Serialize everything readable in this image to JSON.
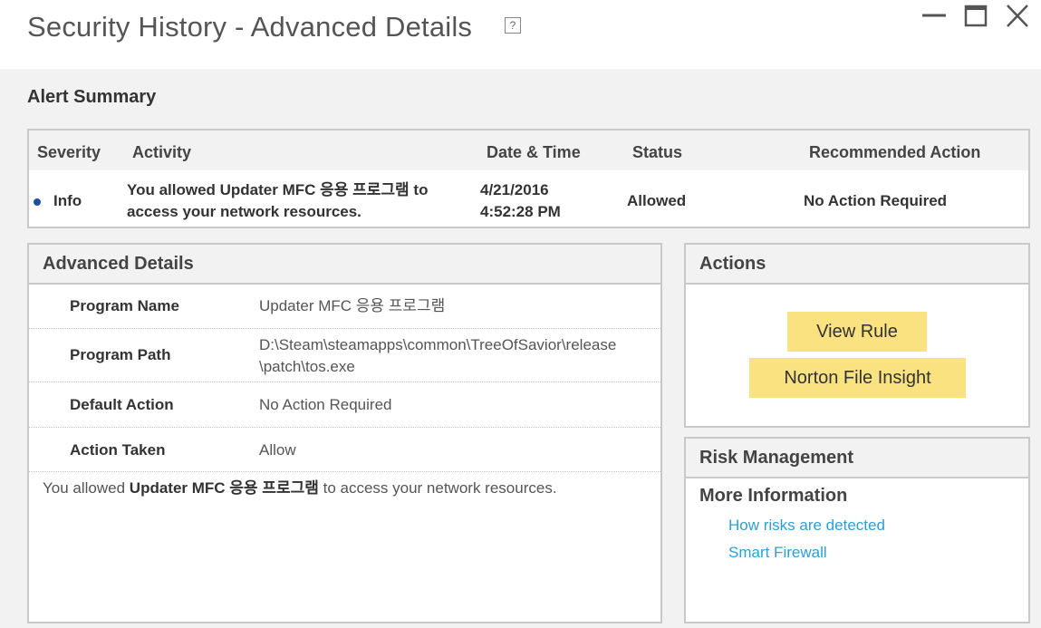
{
  "window": {
    "title": "Security History - Advanced Details",
    "help_glyph": "?"
  },
  "alert_summary": {
    "heading": "Alert Summary",
    "columns": {
      "severity": "Severity",
      "activity": "Activity",
      "datetime": "Date & Time",
      "status": "Status",
      "recommended": "Recommended Action"
    },
    "row": {
      "severity": "Info",
      "activity_line1": "You allowed Updater MFC 응용 프로그램 to",
      "activity_line2": "access your network resources.",
      "date": "4/21/2016",
      "time": "4:52:28 PM",
      "status": "Allowed",
      "recommended": "No Action Required",
      "severity_color": "#1e4fa3"
    }
  },
  "advanced_details": {
    "heading": "Advanced Details",
    "rows": [
      {
        "label": "Program Name",
        "value": "Updater MFC 응용 프로그램"
      },
      {
        "label": "Program Path",
        "value_line1": "D:\\Steam\\steamapps\\common\\TreeOfSavior\\release",
        "value_line2": "\\patch\\tos.exe"
      },
      {
        "label": "Default Action",
        "value": "No Action Required"
      },
      {
        "label": "Action Taken",
        "value": "Allow"
      }
    ],
    "note": {
      "prefix": "You allowed ",
      "program": "Updater MFC 응용 프로그램",
      "suffix": " to access your network resources."
    }
  },
  "actions": {
    "heading": "Actions",
    "view_rule": "View Rule",
    "file_insight": "Norton File Insight",
    "button_color": "#fbe280"
  },
  "risk_management": {
    "heading": "Risk Management",
    "more_info": "More Information",
    "links": [
      "How risks are detected",
      "Smart Firewall"
    ],
    "link_color": "#2ba0d8"
  }
}
